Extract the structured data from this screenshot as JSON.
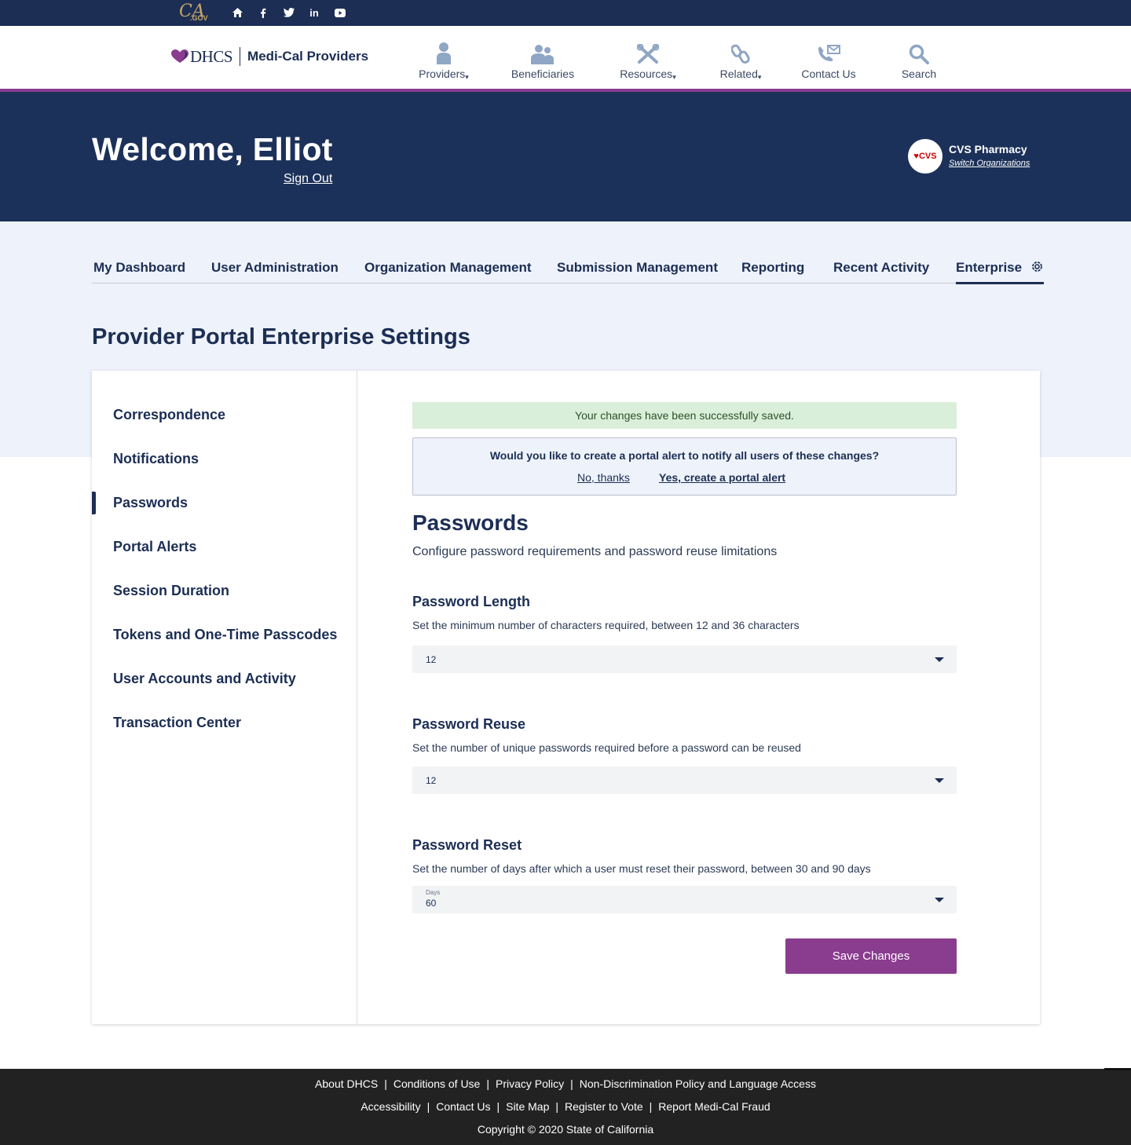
{
  "utility": {
    "ca_logo_text": "CA",
    "ca_logo_sub": ".GOV",
    "social": [
      "home-icon",
      "facebook-icon",
      "twitter-icon",
      "linkedin-icon",
      "youtube-icon"
    ]
  },
  "header": {
    "brand_dhcs": "DHCS",
    "brand_name": "Medi-Cal Providers",
    "nav": [
      {
        "label": "Providers",
        "has_caret": true,
        "icon": "person-icon"
      },
      {
        "label": "Beneficiaries",
        "has_caret": false,
        "icon": "group-icon"
      },
      {
        "label": "Resources",
        "has_caret": true,
        "icon": "tools-icon"
      },
      {
        "label": "Related",
        "has_caret": true,
        "icon": "link-icon"
      },
      {
        "label": "Contact Us",
        "has_caret": false,
        "icon": "phone-mail-icon"
      },
      {
        "label": "Search",
        "has_caret": false,
        "icon": "search-icon"
      }
    ]
  },
  "welcome": {
    "title": "Welcome, Elliot",
    "sign_out": "Sign Out",
    "org_logo": "♥CVS",
    "org_name": "CVS Pharmacy",
    "switch_org": "Switch Organizations"
  },
  "tabs": [
    {
      "label": "My Dashboard"
    },
    {
      "label": "User Administration"
    },
    {
      "label": "Organization Management"
    },
    {
      "label": "Submission Management"
    },
    {
      "label": "Reporting"
    },
    {
      "label": "Recent Activity"
    },
    {
      "label": "Enterprise",
      "active": true
    }
  ],
  "page_title": "Provider Portal Enterprise Settings",
  "sidebar": {
    "items": [
      {
        "label": "Correspondence"
      },
      {
        "label": "Notifications"
      },
      {
        "label": "Passwords",
        "active": true
      },
      {
        "label": "Portal Alerts"
      },
      {
        "label": "Session Duration"
      },
      {
        "label": "Tokens and One-Time Passcodes"
      },
      {
        "label": "User Accounts and Activity"
      },
      {
        "label": "Transaction Center"
      }
    ]
  },
  "content": {
    "success_message": "Your changes have been successfully saved.",
    "alert_prompt": {
      "question": "Would you like to create a portal alert to notify all users of these changes?",
      "no_label": "No, thanks",
      "yes_label": "Yes, create a portal alert"
    },
    "section_title": "Passwords",
    "section_desc": "Configure password requirements and password reuse limitations",
    "fields": {
      "length": {
        "label": "Password Length",
        "help": "Set the minimum number of characters required, between 12 and 36 characters",
        "value": "12"
      },
      "reuse": {
        "label": "Password Reuse",
        "help": "Set the number of unique passwords required before a password can be reused",
        "value": "12"
      },
      "reset": {
        "label": "Password Reset",
        "help": "Set the number of days after which a user must reset their password, between 30 and 90 days",
        "float_label": "Days",
        "value": "60"
      }
    },
    "save_label": "Save Changes"
  },
  "footer": {
    "row1": [
      "About DHCS",
      "Conditions of Use",
      "Privacy Policy",
      "Non-Discrimination Policy and Language Access"
    ],
    "row2": [
      "Accessibility",
      "Contact Us",
      "Site Map",
      "Register to Vote",
      "Report Medi-Cal Fraud"
    ],
    "copyright": "Copyright © 2020 State of California"
  },
  "colors": {
    "navy": "#1c3159",
    "purple": "#8a3c8f",
    "success_bg": "#d9efd9",
    "light_bg": "#eef2fa",
    "footer_bg": "#222222"
  }
}
